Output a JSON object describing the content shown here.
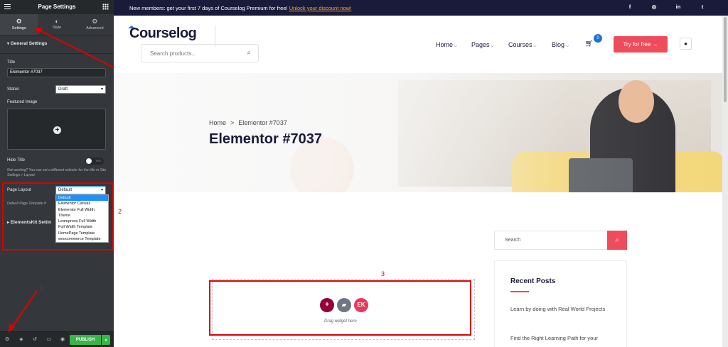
{
  "editor": {
    "title": "Page Settings",
    "tabs": [
      {
        "label": "Settings",
        "icon": "gear-icon"
      },
      {
        "label": "Style",
        "icon": "half-circle-icon"
      },
      {
        "label": "Advanced",
        "icon": "cog-icon"
      }
    ],
    "section_general": "General Settings",
    "title_label": "Title",
    "title_value": "Elementor #7037",
    "status_label": "Status",
    "status_value": "Draft",
    "featured_image_label": "Featured Image",
    "hide_title_label": "Hide Title",
    "hide_title_toggle": "NO",
    "hide_title_note": "Not working? You can set a different selector for the title in Site Settings > Layout",
    "page_layout_label": "Page Layout",
    "page_layout_value": "Default",
    "page_layout_note": "Default Page Template fr",
    "page_layout_options": [
      "Default",
      "Elementor Canvas",
      "Elementor Full Width",
      "Theme",
      "Learnpress Full Width",
      "Full Width Template",
      "HomePage Template",
      "woocommerce Template"
    ],
    "section_elementskit": "ElementsKit Settin",
    "publish_label": "PUBLISH",
    "bottom_icons": [
      "settings-icon",
      "layers-icon",
      "history-icon",
      "responsive-icon",
      "preview-icon"
    ]
  },
  "site": {
    "announcement": "New members: get your first 7 days of Courselog Premium for free!",
    "announcement_link": "Unlock your discount now!",
    "social": [
      "f",
      "◎",
      "in",
      "t"
    ],
    "logo": "Courselog",
    "search_placeholder": "Search products...",
    "nav": [
      "Home",
      "Pages",
      "Courses",
      "Blog"
    ],
    "cart_count": "0",
    "cta": "Try for free →",
    "breadcrumb_home": "Home",
    "breadcrumb_sep": ">",
    "breadcrumb_current": "Elementor #7037",
    "page_title": "Elementor #7037",
    "sidebar_search_placeholder": "Search",
    "recent_posts_title": "Recent Posts",
    "recent_posts": [
      "Learn by doing with Real World Projects",
      "Find the Right Learning Path for your"
    ],
    "drop_text": "Drag widget here"
  },
  "annotations": [
    "1",
    "2",
    "3"
  ],
  "colors": {
    "accent": "#ef4c5b",
    "brand_blue": "#1b75d0",
    "dark": "#1a1b3a",
    "publish": "#39b54a",
    "annotation": "#e00000"
  }
}
